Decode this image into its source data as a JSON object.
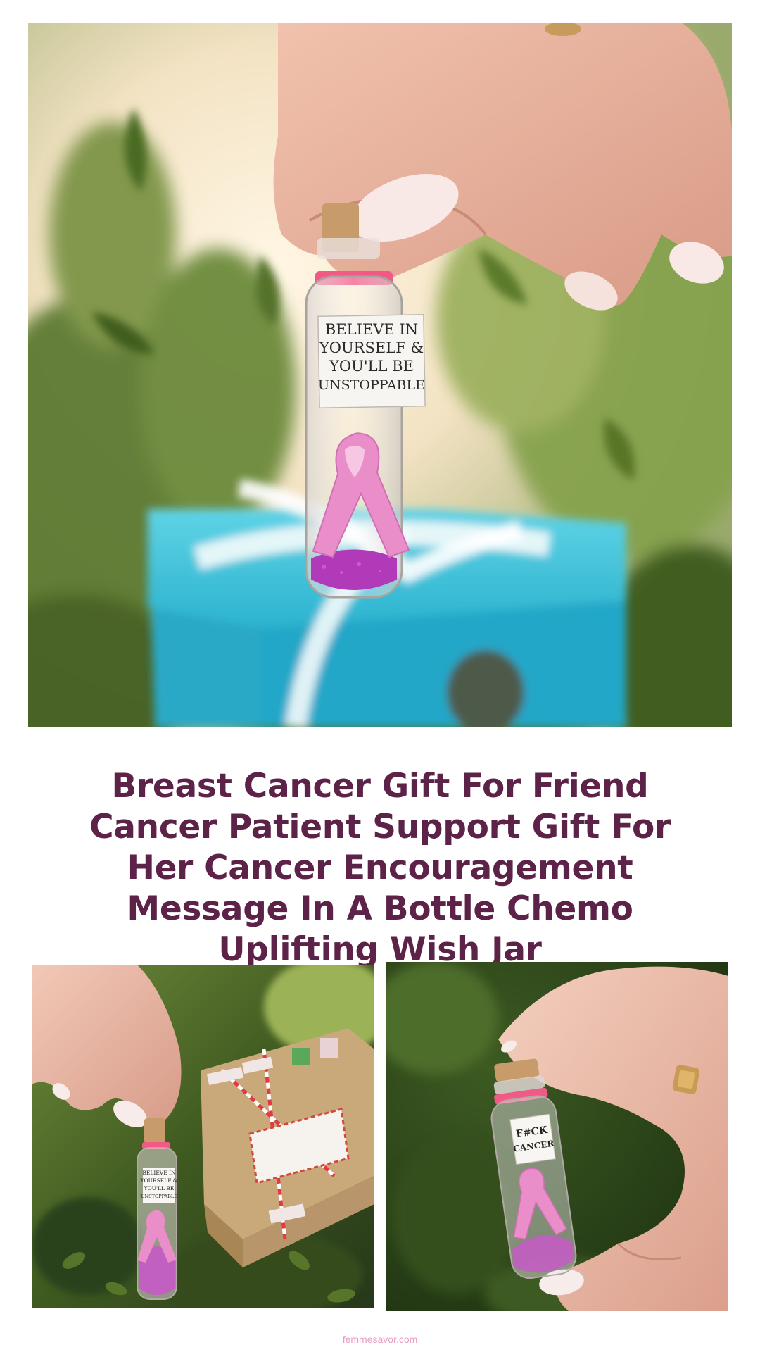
{
  "hero_image": {
    "jar_label_lines": [
      "BELIEVE IN",
      "YOURSELF &",
      "YOU'LL BE",
      "UNSTOPPABLE"
    ],
    "colors": {
      "gift_box": "#3ec6dc",
      "ribbon_pink": "#e98ec8",
      "glitter": "#b03ab8",
      "foliage": "#5a7a2c"
    }
  },
  "title": "Breast Cancer Gift For Friend Cancer Patient Support Gift For Her Cancer Encouragement Message In A Bottle Chemo Uplifting Wish Jar",
  "left_image": {
    "jar_label_lines": [
      "BELIEVE IN",
      "YOURSELF &",
      "YOU'LL BE",
      "UNSTOPPABLE"
    ]
  },
  "right_image": {
    "jar_label_lines": [
      "F#CK",
      "CANCER"
    ]
  },
  "watermark": "femmesavor.com"
}
